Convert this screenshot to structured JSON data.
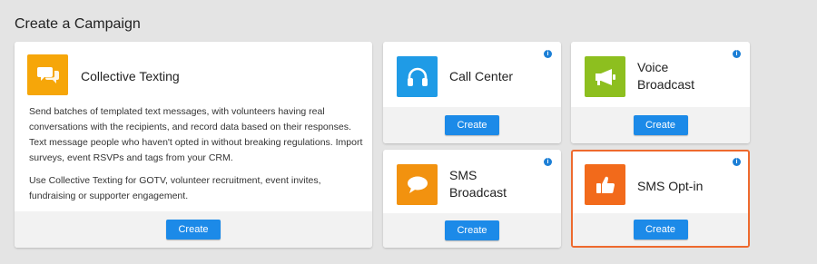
{
  "page_title": "Create a Campaign",
  "colors": {
    "background": "#e4e4e4",
    "button": "#1c8ae8",
    "info": "#1c7fd6",
    "selected_border": "#ee6a2e"
  },
  "cards": {
    "collective_texting": {
      "title": "Collective Texting",
      "icon": "chat-bubbles-icon",
      "icon_color": "#f6a609",
      "description": [
        "Send batches of templated text messages, with volunteers having real conversations with the recipients, and record data based on their responses. Text message people who haven't opted in without breaking regulations. Import surveys, event RSVPs and tags from your CRM.",
        "Use Collective Texting for GOTV, volunteer recruitment, event invites, fundraising or supporter engagement."
      ],
      "button": "Create"
    },
    "call_center": {
      "title": "Call Center",
      "icon": "headset-icon",
      "icon_color": "#1f9be6",
      "info": "i",
      "button": "Create"
    },
    "voice_broadcast": {
      "title_line1": "Voice",
      "title_line2": "Broadcast",
      "icon": "megaphone-icon",
      "icon_color": "#8dbf1f",
      "info": "i",
      "button": "Create"
    },
    "sms_broadcast": {
      "title_line1": "SMS",
      "title_line2": "Broadcast",
      "icon": "speech-bubble-icon",
      "icon_color": "#f2920f",
      "info": "i",
      "button": "Create"
    },
    "sms_optin": {
      "title": "SMS Opt-in",
      "icon": "thumbs-up-icon",
      "icon_color": "#f26a1b",
      "info": "i",
      "button": "Create",
      "selected": true
    }
  }
}
